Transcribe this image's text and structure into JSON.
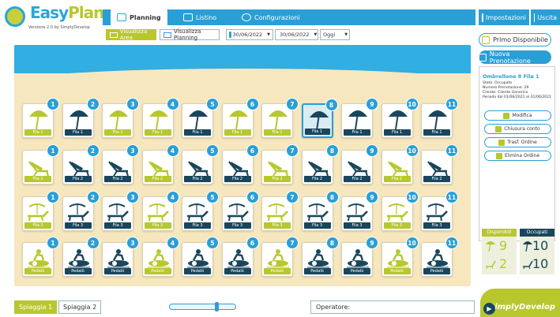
{
  "app": {
    "logo_main": "Easy",
    "logo_accent": "Plan",
    "version": "Versione 2.0 by SimplyDevelop"
  },
  "tabs": [
    {
      "label": "Planning",
      "active": true
    },
    {
      "label": "Listino",
      "active": false
    },
    {
      "label": "Configurazioni",
      "active": false
    }
  ],
  "header": {
    "settings_label": "Impostazioni",
    "exit_label": "Uscita"
  },
  "toolbar": {
    "view_area": "Visualizza Area",
    "view_planning": "Visualizza Planning",
    "date_from": "30/06/2022",
    "date_to": "30/06/2022",
    "period": "Oggi"
  },
  "rows": [
    {
      "type": "ombrellone",
      "label": "Fila 1",
      "count": 11,
      "selected": 8
    },
    {
      "type": "sdraio",
      "label": "Fila 2",
      "count": 11,
      "selected": 0
    },
    {
      "type": "lettino",
      "label": "Fila 3",
      "count": 11,
      "selected": 0
    },
    {
      "type": "pedalo",
      "label": "Pedalò",
      "count": 11,
      "selected": 0
    }
  ],
  "side": {
    "first_available": "Primo Disponibile",
    "new_booking": "Nuova Prenotazione",
    "info_title": "Ombrellone 8 Fila 1",
    "info_lines": [
      "Stato: Occupato",
      "Numero Prenotazione: 29",
      "Cliente: Cliente Generico",
      "Periodo dal 01/06/2021 al 31/06/2021"
    ],
    "actions": [
      "Modifica",
      "Chiusura conto",
      "Trasf. Ordine",
      "Elimina Ordine"
    ]
  },
  "stats": {
    "available_label": "Disponibili",
    "occupied_label": "Occupati",
    "available_umbrellas": "9",
    "available_beds": "2",
    "occupied_umbrellas": "10",
    "occupied_beds": "10"
  },
  "bottom": {
    "beach_tabs": [
      "Spiaggia 1",
      "Spiaggia 2"
    ],
    "operator_label": "Operatore:",
    "zoom_level": 0.7,
    "brand": "SimplyDevelop"
  },
  "colors": {
    "blue": "#2a9fd6",
    "green": "#b8c72d",
    "dark": "#19465c",
    "sand": "#f6e7bf"
  }
}
